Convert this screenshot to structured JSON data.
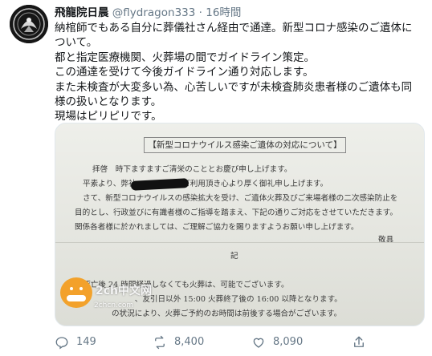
{
  "tweet": {
    "display_name": "飛龍院日晨",
    "handle": "@flydragon333",
    "separator": "·",
    "time": "16時間",
    "lines": [
      "納棺師でもある自分に葬儀社さん経由で通達。新型コロナ感染のご遺体に",
      "ついて。",
      "都と指定医療機関、火葬場の間でガイドライン策定。",
      "この通達を受けて今後ガイドライン通り対応します。",
      "また未検査が大変多い為、心苦しいですが未検査肺炎患者様のご遺体も同",
      "様の扱いとなります。",
      "現場はピリピリです。"
    ]
  },
  "document": {
    "title": "【新型コロナウイルス感染ご遺体の対応について】",
    "lines": [
      "拝啓　時下ますますご清栄のこととお慶び申し上げます。",
      "平素より、弊社　　　　　をご利用頂き心より厚く御礼申し上げます。",
      "さて、新型コロナウイルスの感染拡大を受け、ご遺体火葬及びご来場者様の二次感染防止を",
      "目的とし、行政並びに有識者様のご指導を踏まえ、下記の通りご対応をさせていただきます。",
      "関係各者様に於かれましては、ご理解ご協力を賜りますようお願い申し上げます。",
      "敬具",
      "記",
      "1.  死亡後 24 時間経過しなくても火葬は、可能でございます。",
      "　　　　　　　　、友引日以外 15:00 火葬終了後の 16:00 以降となります。",
      "　　　　　の状況により、火葬ご予約のお時間は前後する場合がございます。"
    ]
  },
  "watermark": {
    "text1": "2ch中文网",
    "text2": "2chcn.com"
  },
  "actions": {
    "reply_count": "149",
    "retweet_count": "8,400",
    "like_count": "8,090"
  },
  "colors": {
    "text": "#14171a",
    "secondary": "#657786",
    "border": "#e1e8ed"
  }
}
